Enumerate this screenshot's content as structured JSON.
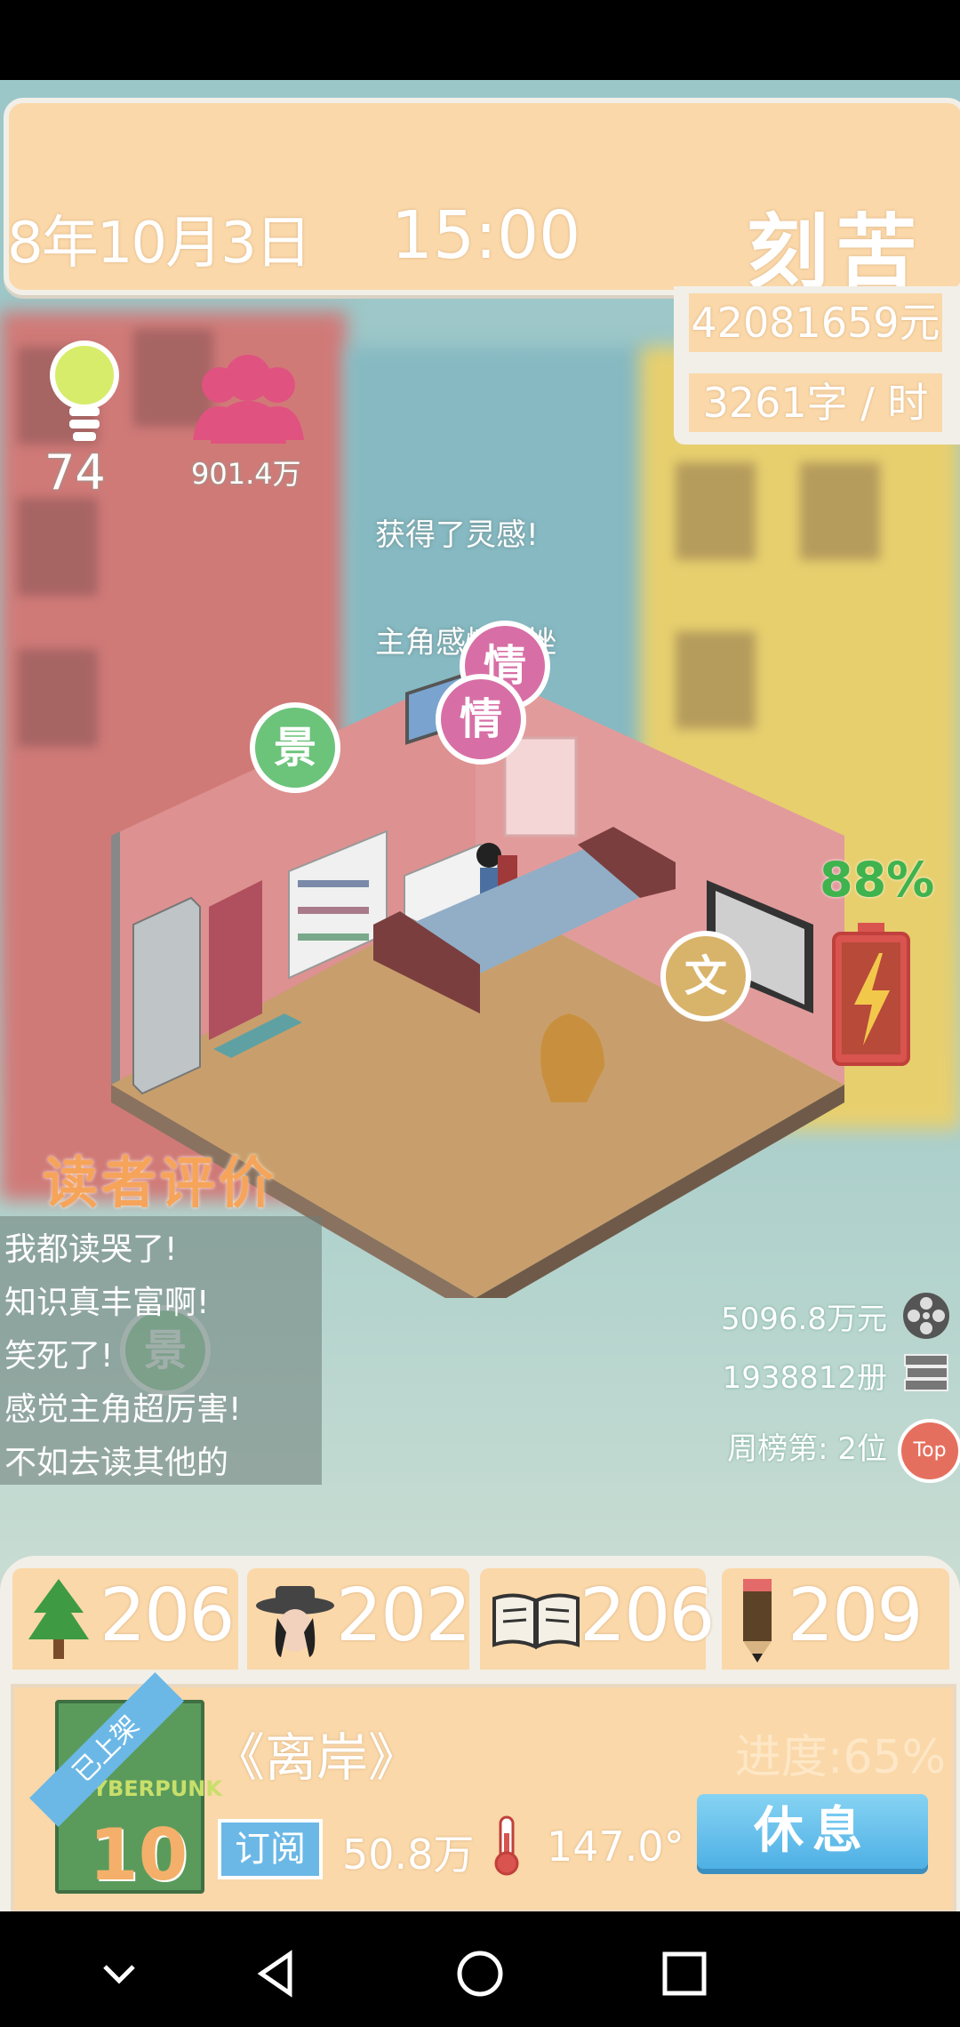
{
  "header": {
    "date": "8年10月3日",
    "time": "15:00",
    "mood": "刻苦",
    "money": "42081659元",
    "speed": "3261字 / 时"
  },
  "stats": {
    "inspiration": "74",
    "fans": "901.4万"
  },
  "floating_text": {
    "line1": "获得了灵感!",
    "line2": "主角感情受挫"
  },
  "bubbles": {
    "scene": "景",
    "emotion": "情",
    "text": "文"
  },
  "battery": {
    "percent_label": "88%",
    "level": 0.88
  },
  "reviews": {
    "title": "读者评价",
    "items": [
      "我都读哭了!",
      "知识真丰富啊!",
      "笑死了!",
      "感觉主角超厉害!",
      "不如去读其他的"
    ]
  },
  "right_stats": {
    "revenue": "5096.8万元",
    "copies": "1938812册",
    "rank": "周榜第: 2位",
    "top_badge": "Top"
  },
  "attributes": [
    {
      "icon": "tree-icon",
      "value": "206"
    },
    {
      "icon": "detective-icon",
      "value": "202"
    },
    {
      "icon": "open-book-icon",
      "value": "206"
    },
    {
      "icon": "pencil-icon",
      "value": "209"
    }
  ],
  "book": {
    "ribbon": "已上架",
    "cover_text": "CYBERPUNK",
    "cover_number": "10",
    "title": "《离岸》",
    "progress": "进度:65%",
    "subscribe_label": "订阅",
    "subscribers": "50.8万",
    "temperature": "147.0°",
    "rest_button": "休息"
  },
  "colors": {
    "header_bg": "#fad8a9",
    "accent_blue": "#6bb8e6",
    "battery_green": "#3fb34d"
  }
}
